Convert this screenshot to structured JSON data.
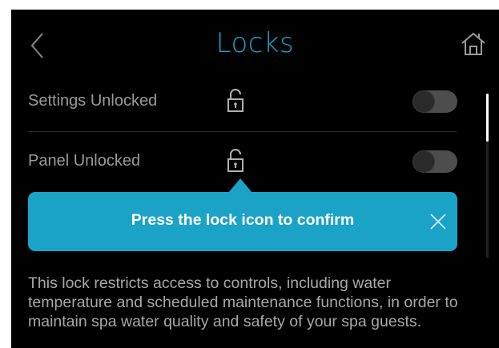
{
  "header": {
    "title": "Locks",
    "back_icon": "chevron-left-icon",
    "home_icon": "home-icon",
    "title_color": "#1aa3c6"
  },
  "rows": [
    {
      "label": "Settings Unlocked",
      "lock_icon": "unlocked-padlock-icon",
      "toggle_on": false
    },
    {
      "label": "Panel Unlocked",
      "lock_icon": "unlocked-padlock-icon",
      "toggle_on": false
    }
  ],
  "tooltip": {
    "text": "Press the lock icon to confirm",
    "close_icon": "close-icon",
    "color": "#1aa3c6"
  },
  "description": "This lock restricts access to controls, including water temperature and scheduled maintenance functions, in order to maintain spa water quality and safety of your spa guests."
}
